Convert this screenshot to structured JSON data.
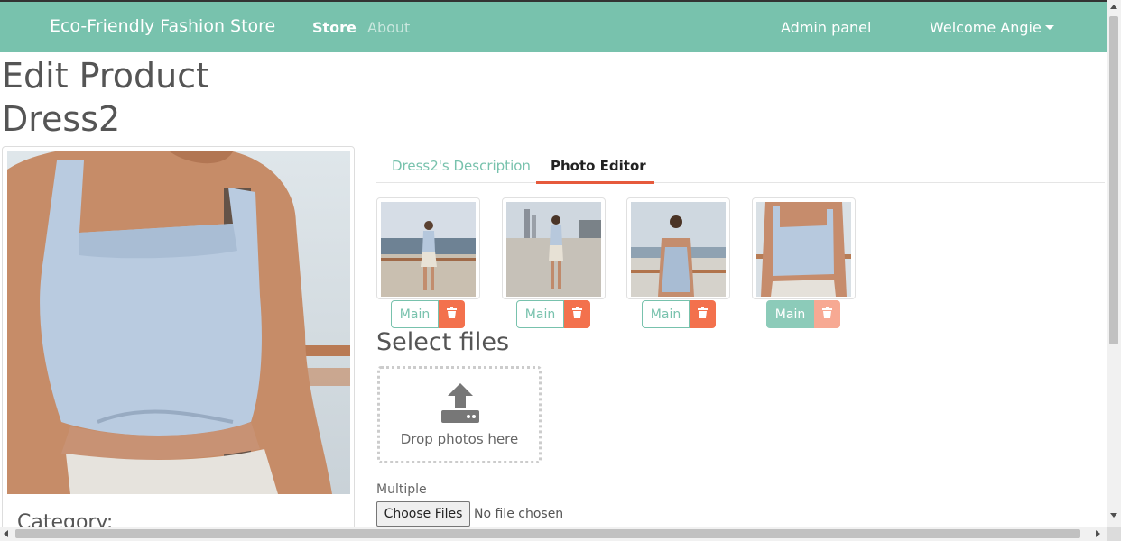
{
  "navbar": {
    "brand": "Eco-Friendly Fashion Store",
    "store": "Store",
    "about": "About",
    "admin": "Admin panel",
    "welcome": "Welcome Angie"
  },
  "page": {
    "title_line1": "Edit Product",
    "title_line2": "Dress2",
    "category_label": "Category:"
  },
  "tabs": {
    "description": "Dress2's Description",
    "photo_editor": "Photo Editor"
  },
  "thumbnails": [
    {
      "main_label": "Main",
      "is_main": false
    },
    {
      "main_label": "Main",
      "is_main": false
    },
    {
      "main_label": "Main",
      "is_main": false
    },
    {
      "main_label": "Main",
      "is_main": true
    }
  ],
  "upload": {
    "section_title": "Select files",
    "drop_text": "Drop photos here",
    "multiple_label": "Multiple",
    "choose_button": "Choose Files",
    "no_file": "No file chosen"
  },
  "colors": {
    "primary": "#78c2ad",
    "danger": "#f3714d",
    "tab_active_underline": "#e65a3c"
  }
}
